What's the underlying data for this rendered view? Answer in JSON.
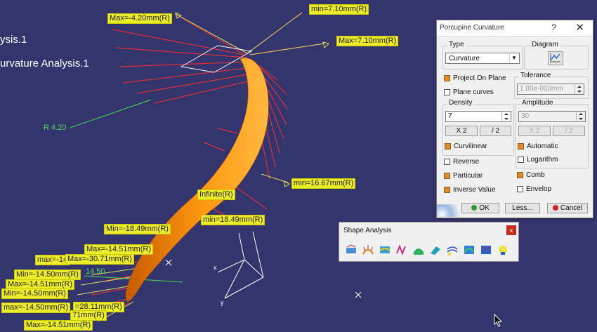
{
  "tree": {
    "item1": "ysis.1",
    "item2": "urvature Analysis.1"
  },
  "labels": {
    "max_top": "Max=-4.20mm(R)",
    "min_top": "min=7.10mm(R)",
    "max_right": "Max=7.10mm(R)",
    "radius": "R 4.20",
    "min_mid": "min=16.67mm(R)",
    "infinite": "Infinite(R)",
    "min_neg": "Min=-18.49mm(R)",
    "min_pos": "min=18.49mm(R)",
    "max_1451a": "Max=-14.51mm(R)",
    "max_1451b": "max=-14",
    "max_3071": "Max=-30.71mm(R)",
    "min_1450a": "Min=-14.50mm(R)",
    "max_1451c": "Max=-14.51mm(R)",
    "min_1450b": "Min=-14.50mm(R)",
    "max_1450": "max=-14.50mm(R)",
    "mmr_a": "=28.11mm(R)",
    "mmr_b": "71mm(R)",
    "max_1451d": "Max=-14.51mm(R)",
    "value_1450": "14.50"
  },
  "dialog": {
    "title": "Porcupine Curvature",
    "help": "?",
    "close": "✕",
    "type_group": "Type",
    "type_value": "Curvature",
    "diagram_group": "Diagram",
    "project_on_plane": "Project On Plane",
    "plane_curves": "Plane curves",
    "tolerance_group": "Tolerance",
    "tolerance_value": "1.00e-003mm",
    "density_group": "Density",
    "density_value": "7",
    "x2": "X 2",
    "div2": "/ 2",
    "curvilinear": "Curvilinear",
    "amplitude_group": "Amplitude",
    "amplitude_value": "30",
    "amp_x2": "X 2",
    "amp_div2": "/ 2",
    "automatic": "Automatic",
    "logarithm": "Logarithm",
    "reverse": "Reverse",
    "particular": "Particular",
    "inverse_value": "Inverse Value",
    "comb": "Comb",
    "envelop": "Envelop",
    "ok": "OK",
    "less": "Less...",
    "cancel": "Cancel"
  },
  "toolbar": {
    "title": "Shape Analysis",
    "close": "x",
    "icons": [
      "connect-checker-icon",
      "porcupine-curvature-icon",
      "surfacic-curvature-icon",
      "draft-analysis-icon",
      "distance-analysis-icon",
      "cutting-plane-icon",
      "reflection-lines-icon",
      "inflection-lines-icon",
      "highlight-lines-icon",
      "environment-mapping-icon"
    ]
  },
  "colors": {
    "background": "#34346e",
    "tag": "#ecec2a",
    "surface": "#ff8c00",
    "comb_red": "#ff3030",
    "comb_yellow": "#e0e060"
  }
}
